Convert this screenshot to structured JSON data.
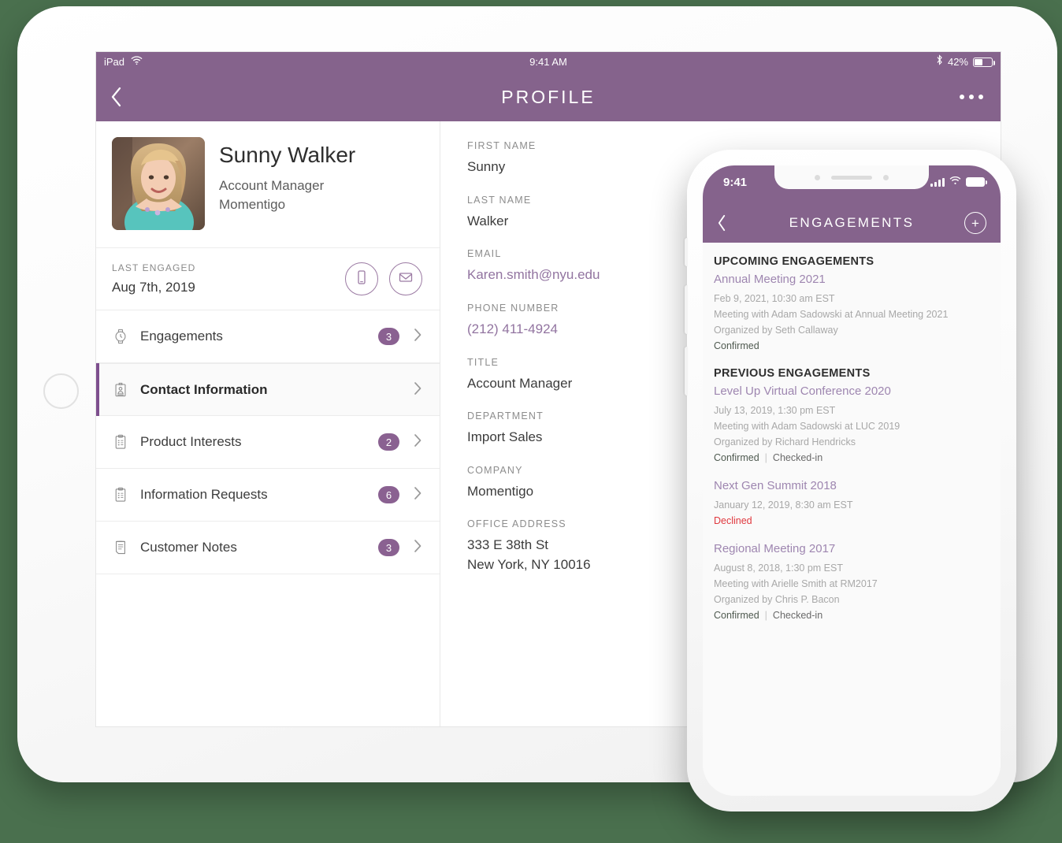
{
  "colors": {
    "brand_purple": "#85638c",
    "accent_purple": "#7e4f8e",
    "link_purple": "#9274a0",
    "badge_purple": "#8a6191",
    "background_green": "#4a704e",
    "declined_red": "#e0383e"
  },
  "tablet": {
    "statusbar": {
      "carrier": "iPad",
      "wifi_icon": "wifi-icon",
      "time": "9:41 AM",
      "bluetooth_icon": "bluetooth-icon",
      "battery_percent": "42%",
      "battery_icon": "battery-icon"
    },
    "navbar": {
      "back_icon": "chevron-left-icon",
      "title": "PROFILE",
      "more_icon": "more-horizontal-icon"
    },
    "profile": {
      "avatar_alt": "avatar",
      "name": "Sunny Walker",
      "role": "Account Manager",
      "company": "Momentigo"
    },
    "last_engaged": {
      "label": "LAST ENGAGED",
      "value": "Aug 7th, 2019",
      "phone_action": "phone-icon",
      "email_action": "envelope-icon"
    },
    "menu": [
      {
        "label": "Engagements",
        "badge": "3",
        "icon": "watch-icon",
        "selected": false
      },
      {
        "label": "Contact Information",
        "badge": "",
        "icon": "id-badge-icon",
        "selected": true
      },
      {
        "label": "Product Interests",
        "badge": "2",
        "icon": "clipboard-icon",
        "selected": false
      },
      {
        "label": "Information Requests",
        "badge": "6",
        "icon": "clipboard-icon",
        "selected": false
      },
      {
        "label": "Customer Notes",
        "badge": "3",
        "icon": "notes-icon",
        "selected": false
      }
    ],
    "details": [
      {
        "label": "FIRST NAME",
        "value": "Sunny",
        "link": false
      },
      {
        "label": "LAST NAME",
        "value": "Walker",
        "link": false
      },
      {
        "label": "EMAIL",
        "value": "Karen.smith@nyu.edu",
        "link": true
      },
      {
        "label": "PHONE NUMBER",
        "value": "(212) 411-4924",
        "link": true
      },
      {
        "label": "TITLE",
        "value": "Account Manager",
        "link": false
      },
      {
        "label": "DEPARTMENT",
        "value": "Import Sales",
        "link": false
      },
      {
        "label": "COMPANY",
        "value": "Momentigo",
        "link": false
      },
      {
        "label": "OFFICE ADDRESS",
        "value": "333 E 38th St\nNew York, NY 10016",
        "link": false
      }
    ]
  },
  "phone": {
    "statusbar": {
      "time": "9:41",
      "signal_icon": "signal-bars-icon",
      "wifi_icon": "wifi-icon",
      "battery_icon": "battery-icon"
    },
    "navbar": {
      "back_icon": "chevron-left-icon",
      "title": "ENGAGEMENTS",
      "add_icon": "plus-circle-icon",
      "add_label": "+"
    },
    "sections": [
      {
        "heading": "UPCOMING ENGAGEMENTS",
        "items": [
          {
            "title": "Annual Meeting 2021",
            "datetime": "Feb 9, 2021, 10:30 am EST",
            "meeting": "Meeting with Adam Sadowski at Annual Meeting 2021",
            "organizer": "Organized by Seth Callaway",
            "status_primary": "Confirmed",
            "status_secondary": "",
            "declined": false
          }
        ]
      },
      {
        "heading": "PREVIOUS ENGAGEMENTS",
        "items": [
          {
            "title": "Level Up Virtual Conference 2020",
            "datetime": "July 13, 2019, 1:30 pm EST",
            "meeting": "Meeting with Adam Sadowski at LUC 2019",
            "organizer": "Organized by Richard Hendricks",
            "status_primary": "Confirmed",
            "status_secondary": "Checked-in",
            "declined": false
          },
          {
            "title": "Next Gen Summit 2018",
            "datetime": "January 12, 2019, 8:30 am EST",
            "meeting": "",
            "organizer": "",
            "status_primary": "Declined",
            "status_secondary": "",
            "declined": true
          },
          {
            "title": "Regional Meeting 2017",
            "datetime": "August 8, 2018, 1:30 pm EST",
            "meeting": "Meeting with Arielle Smith at RM2017",
            "organizer": "Organized by Chris P. Bacon",
            "status_primary": "Confirmed",
            "status_secondary": "Checked-in",
            "declined": false
          }
        ]
      }
    ]
  }
}
